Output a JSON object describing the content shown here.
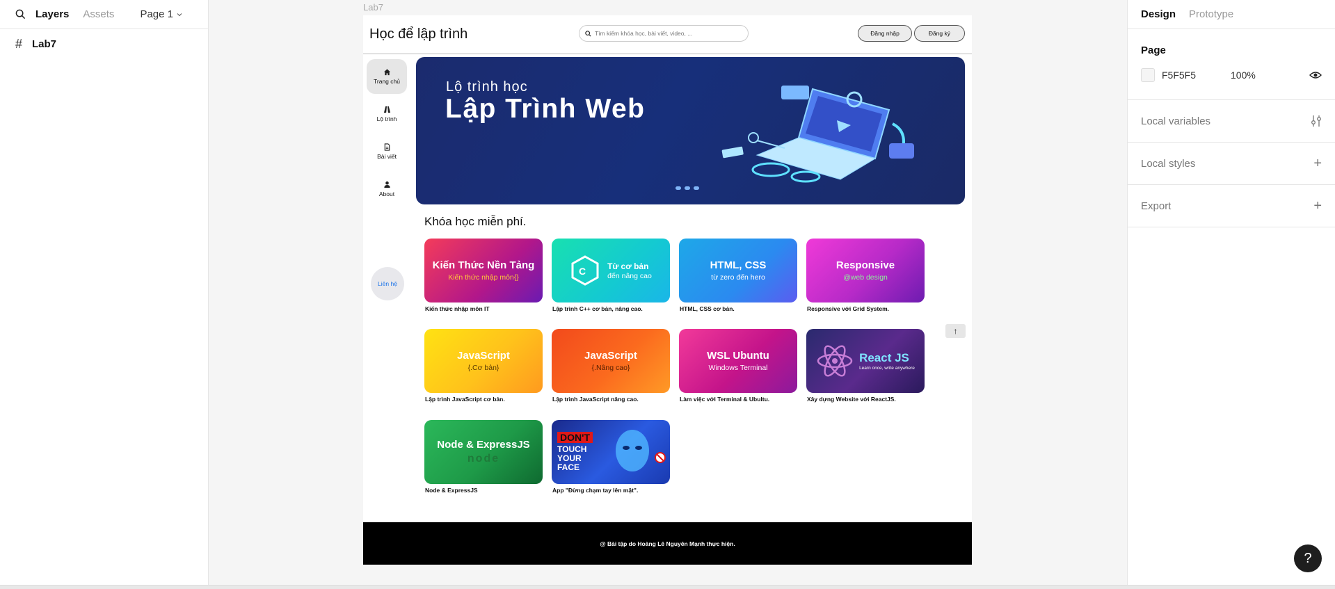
{
  "left_panel": {
    "tab_layers": "Layers",
    "tab_assets": "Assets",
    "page_select": "Page 1",
    "layer_name": "Lab7"
  },
  "right_panel": {
    "tab_design": "Design",
    "tab_prototype": "Prototype",
    "page_title": "Page",
    "page_color": "F5F5F5",
    "page_opacity": "100%",
    "local_variables": "Local variables",
    "local_styles": "Local styles",
    "export": "Export",
    "help": "?"
  },
  "frame": {
    "label": "Lab7",
    "site_title": "Học để lập trình",
    "search_placeholder": "Tìm kiếm khóa học, bài viết, video, ...",
    "login": "Đăng nhập",
    "register": "Đăng ký",
    "nav": [
      {
        "label": "Trang chủ",
        "icon": "home-icon"
      },
      {
        "label": "Lộ trình",
        "icon": "road-icon"
      },
      {
        "label": "Bài viết",
        "icon": "document-icon"
      },
      {
        "label": "About",
        "icon": "user-icon"
      }
    ],
    "contact": "Liên hệ",
    "banner": {
      "subtitle": "Lộ trình học",
      "title": "Lập Trình Web"
    },
    "section_title": "Khóa học miễn phí.",
    "courses": [
      {
        "title": "Kiến Thức Nền Tảng",
        "subtitle": "Kiến thức nhập môn{}",
        "caption": "Kiến thức nhập môn IT"
      },
      {
        "title": "Từ cơ bản",
        "subtitle": "đến nâng cao",
        "caption": "Lập trình C++ cơ bản, nâng cao."
      },
      {
        "title": "HTML, CSS",
        "subtitle": "từ zero đến hero",
        "caption": "HTML, CSS cơ bản."
      },
      {
        "title": "Responsive",
        "subtitle": "@web design",
        "caption": "Responsive với Grid System."
      },
      {
        "title": "JavaScript",
        "subtitle": "{.Cơ bản}",
        "caption": "Lập trình JavaScript cơ bản."
      },
      {
        "title": "JavaScript",
        "subtitle": "{.Nâng cao}",
        "caption": "Lập trình JavaScript nâng cao."
      },
      {
        "title": "WSL Ubuntu",
        "subtitle": "Windows Terminal",
        "caption": "Làm việc với Terminal & Ubultu."
      },
      {
        "title": "React JS",
        "subtitle": "Learn once, write anywhere",
        "caption": "Xây dựng Website với ReactJS."
      },
      {
        "title": "Node & ExpressJS",
        "subtitle": "node",
        "caption": "Node & ExpressJS"
      },
      {
        "title": "DON'T",
        "subtitle": "TOUCH YOUR FACE",
        "caption": "App \"Đừng chạm tay lên mặt\"."
      }
    ],
    "footer": "@ Bài tập do Hoàng Lê Nguyên Mạnh thực hiện.",
    "to_top": "↑"
  }
}
